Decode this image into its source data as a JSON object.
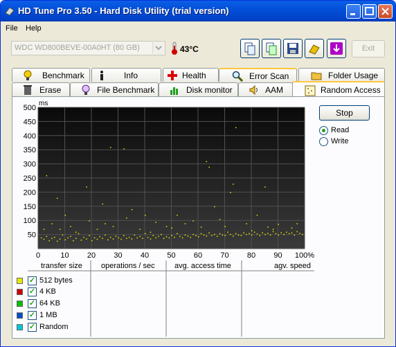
{
  "window": {
    "title": "HD Tune Pro 3.50 - Hard Disk Utility (trial version)"
  },
  "menu": [
    "File",
    "Help"
  ],
  "toolbar": {
    "drive": "WDC WD800BEVE-00A0HT (80 GB)",
    "temperature": "43°C",
    "exit_label": "Exit"
  },
  "tabs_row1": [
    {
      "label": "Benchmark",
      "icon": "benchmark-icon"
    },
    {
      "label": "Info",
      "icon": "info-icon"
    },
    {
      "label": "Health",
      "icon": "health-icon"
    },
    {
      "label": "Error Scan",
      "icon": "error-scan-icon"
    },
    {
      "label": "Folder Usage",
      "icon": "folder-icon"
    }
  ],
  "tabs_row2": [
    {
      "label": "Erase",
      "icon": "erase-icon"
    },
    {
      "label": "File Benchmark",
      "icon": "file-benchmark-icon"
    },
    {
      "label": "Disk monitor",
      "icon": "disk-monitor-icon"
    },
    {
      "label": "AAM",
      "icon": "aam-icon"
    },
    {
      "label": "Random Access",
      "icon": "random-access-icon",
      "active": true
    }
  ],
  "controls": {
    "stop_label": "Stop",
    "read_label": "Read",
    "write_label": "Write",
    "selected_mode": "Read"
  },
  "table": {
    "headers": [
      "transfer size",
      "operations / sec",
      "avg. access time",
      "agv. speed"
    ],
    "rows": [
      {
        "label": "512 bytes",
        "color": "#e8e800",
        "checked": true
      },
      {
        "label": "4 KB",
        "color": "#cc0000",
        "checked": true
      },
      {
        "label": "64 KB",
        "color": "#00c000",
        "checked": true
      },
      {
        "label": "1 MB",
        "color": "#0050c8",
        "checked": true
      },
      {
        "label": "Random",
        "color": "#00c8d8",
        "checked": true
      }
    ]
  },
  "chart_data": {
    "type": "scatter",
    "ylabel": "ms",
    "ylim": [
      0,
      500
    ],
    "xlim": [
      0,
      100
    ],
    "yticks": [
      "500",
      "450",
      "400",
      "350",
      "300",
      "250",
      "200",
      "150",
      "100",
      "50"
    ],
    "xticks": [
      "0",
      "10",
      "20",
      "30",
      "40",
      "50",
      "60",
      "70",
      "80",
      "90",
      "100%"
    ],
    "grid": true,
    "background": "#000000",
    "series": [
      {
        "color": "#e8e800",
        "points": [
          [
            1,
            40
          ],
          [
            2,
            35
          ],
          [
            3,
            45
          ],
          [
            4,
            30
          ],
          [
            5,
            38
          ],
          [
            6,
            42
          ],
          [
            7,
            28
          ],
          [
            8,
            36
          ],
          [
            9,
            50
          ],
          [
            10,
            33
          ],
          [
            11,
            40
          ],
          [
            12,
            45
          ],
          [
            13,
            30
          ],
          [
            14,
            38
          ],
          [
            15,
            55
          ],
          [
            16,
            32
          ],
          [
            17,
            42
          ],
          [
            18,
            36
          ],
          [
            19,
            48
          ],
          [
            20,
            30
          ],
          [
            21,
            40
          ],
          [
            22,
            35
          ],
          [
            23,
            44
          ],
          [
            24,
            38
          ],
          [
            25,
            50
          ],
          [
            26,
            33
          ],
          [
            27,
            42
          ],
          [
            28,
            36
          ],
          [
            29,
            46
          ],
          [
            30,
            40
          ],
          [
            31,
            35
          ],
          [
            32,
            48
          ],
          [
            33,
            38
          ],
          [
            34,
            42
          ],
          [
            35,
            36
          ],
          [
            36,
            50
          ],
          [
            37,
            40
          ],
          [
            38,
            45
          ],
          [
            39,
            38
          ],
          [
            40,
            55
          ],
          [
            41,
            42
          ],
          [
            42,
            36
          ],
          [
            43,
            48
          ],
          [
            44,
            40
          ],
          [
            45,
            45
          ],
          [
            46,
            52
          ],
          [
            47,
            38
          ],
          [
            48,
            44
          ],
          [
            49,
            40
          ],
          [
            50,
            48
          ],
          [
            51,
            42
          ],
          [
            52,
            55
          ],
          [
            53,
            45
          ],
          [
            54,
            40
          ],
          [
            55,
            50
          ],
          [
            56,
            46
          ],
          [
            57,
            42
          ],
          [
            58,
            52
          ],
          [
            59,
            48
          ],
          [
            60,
            44
          ],
          [
            61,
            55
          ],
          [
            62,
            50
          ],
          [
            63,
            46
          ],
          [
            64,
            58
          ],
          [
            65,
            48
          ],
          [
            66,
            52
          ],
          [
            67,
            45
          ],
          [
            68,
            55
          ],
          [
            69,
            50
          ],
          [
            70,
            48
          ],
          [
            71,
            60
          ],
          [
            72,
            52
          ],
          [
            73,
            46
          ],
          [
            74,
            55
          ],
          [
            75,
            50
          ],
          [
            76,
            48
          ],
          [
            77,
            58
          ],
          [
            78,
            52
          ],
          [
            79,
            55
          ],
          [
            80,
            50
          ],
          [
            81,
            60
          ],
          [
            82,
            54
          ],
          [
            83,
            48
          ],
          [
            84,
            58
          ],
          [
            85,
            52
          ],
          [
            86,
            56
          ],
          [
            87,
            50
          ],
          [
            88,
            62
          ],
          [
            89,
            55
          ],
          [
            90,
            50
          ],
          [
            91,
            58
          ],
          [
            92,
            52
          ],
          [
            93,
            60
          ],
          [
            94,
            55
          ],
          [
            95,
            58
          ],
          [
            96,
            50
          ],
          [
            97,
            62
          ],
          [
            98,
            56
          ],
          [
            99,
            52
          ],
          [
            2,
            70
          ],
          [
            3,
            260
          ],
          [
            5,
            90
          ],
          [
            7,
            180
          ],
          [
            8,
            70
          ],
          [
            10,
            120
          ],
          [
            12,
            80
          ],
          [
            14,
            60
          ],
          [
            18,
            220
          ],
          [
            19,
            100
          ],
          [
            22,
            70
          ],
          [
            24,
            160
          ],
          [
            25,
            90
          ],
          [
            27,
            360
          ],
          [
            28,
            80
          ],
          [
            32,
            355
          ],
          [
            33,
            110
          ],
          [
            35,
            140
          ],
          [
            38,
            70
          ],
          [
            40,
            120
          ],
          [
            42,
            60
          ],
          [
            44,
            95
          ],
          [
            48,
            80
          ],
          [
            50,
            75
          ],
          [
            52,
            120
          ],
          [
            55,
            90
          ],
          [
            58,
            100
          ],
          [
            61,
            78
          ],
          [
            63,
            310
          ],
          [
            64,
            290
          ],
          [
            66,
            150
          ],
          [
            68,
            105
          ],
          [
            70,
            80
          ],
          [
            72,
            200
          ],
          [
            73,
            230
          ],
          [
            74,
            430
          ],
          [
            78,
            90
          ],
          [
            80,
            65
          ],
          [
            82,
            120
          ],
          [
            85,
            220
          ],
          [
            86,
            78
          ],
          [
            88,
            70
          ],
          [
            90,
            88
          ],
          [
            93,
            60
          ],
          [
            95,
            75
          ],
          [
            97,
            90
          ]
        ]
      }
    ]
  }
}
